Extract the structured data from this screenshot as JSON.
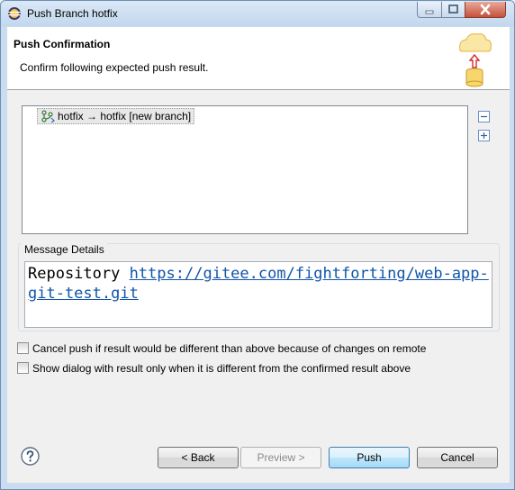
{
  "window": {
    "title": "Push Branch hotfix",
    "icons": {
      "app": "eclipse-icon",
      "minimize": "minimize-icon",
      "maximize": "maximize-icon",
      "close": "close-icon"
    }
  },
  "header": {
    "title": "Push Confirmation",
    "description": "Confirm following expected push result.",
    "banner_icon": "cloud-upload-database-icon"
  },
  "tree": {
    "items": [
      {
        "label": "hotfix → hotfix [new branch]",
        "icon": "branch-push-icon"
      }
    ],
    "collapse_icon": "collapse-all-icon",
    "expand_icon": "expand-all-icon"
  },
  "message": {
    "group_label": "Message Details",
    "prefix": "Repository ",
    "link": "https://gitee.com/fightforting/web-app-git-test.git"
  },
  "options": [
    {
      "label": "Cancel push if result would be different than above because of changes on remote",
      "checked": false
    },
    {
      "label": "Show dialog with result only when it is different from the confirmed result above",
      "checked": false
    }
  ],
  "buttons": {
    "back": "< Back",
    "preview": "Preview >",
    "push": "Push",
    "cancel": "Cancel",
    "help_icon": "help-icon"
  },
  "colors": {
    "titlebar": "#c9dcf0",
    "link": "#1155aa",
    "default_button_border": "#3c7fb1"
  }
}
